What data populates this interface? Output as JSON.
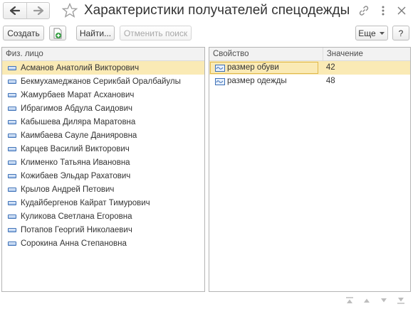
{
  "window": {
    "title": "Характеристики получателей спецодежды"
  },
  "icons": {
    "back": "arrow-left-icon",
    "forward": "arrow-right-icon",
    "favorite": "star-icon",
    "link": "link-icon",
    "more": "more-vertical-icon",
    "close": "close-icon",
    "add_copy": "add-document-icon",
    "row": "list-item-icon",
    "property": "property-icon"
  },
  "toolbar": {
    "create_label": "Создать",
    "find_label": "Найти...",
    "cancel_search_label": "Отменить поиск",
    "more_label": "Еще",
    "help_label": "?"
  },
  "persons": {
    "column_header": "Физ. лицо",
    "selected_index": 0,
    "items": [
      "Асманов Анатолий Викторович",
      "Бекмухамеджанов Серикбай Оралбайулы",
      "Жамурбаев Марат Асханович",
      "Ибрагимов Абдула Саидович",
      "Кабышева Диляра Маратовна",
      "Каимбаева Сауле Данияровна",
      "Карцев Василий Викторович",
      "Клименко Татьяна Ивановна",
      "Кожибаев Эльдар Рахатович",
      "Крылов Андрей Петович",
      "Кудайбергенов Кайрат Тимурович",
      "Куликова Светлана Егоровна",
      "Потапов Георгий Николаевич",
      "Сорокина Анна Степановна"
    ]
  },
  "properties": {
    "column_property": "Свойство",
    "column_value": "Значение",
    "selected_index": 0,
    "rows": [
      {
        "name": "размер обуви",
        "value": "42"
      },
      {
        "name": "размер одежды",
        "value": "48"
      }
    ]
  },
  "colors": {
    "selection": "#faeab5",
    "border": "#b4b4b4",
    "accent_blue": "#3b6fb6",
    "add_green": "#2e9b3c"
  }
}
